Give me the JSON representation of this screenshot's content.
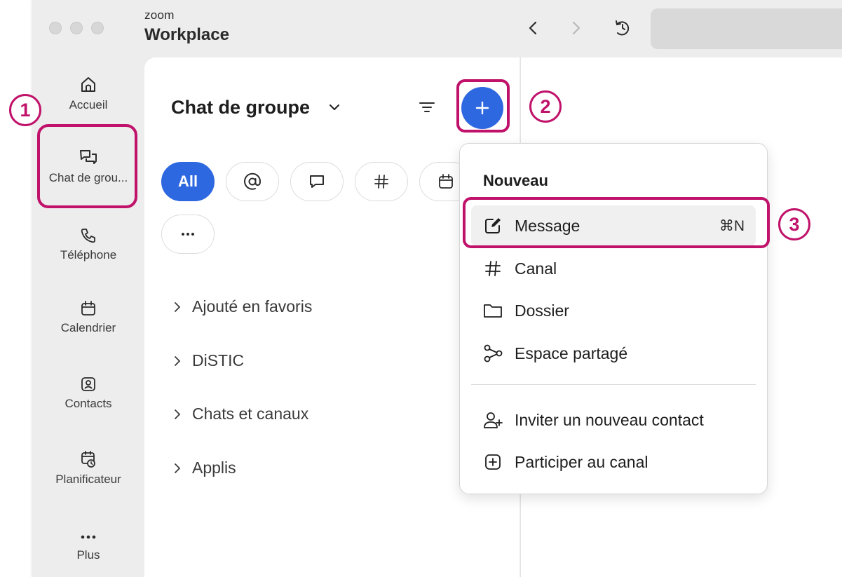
{
  "app": {
    "brand_top": "zoom",
    "brand_name": "Workplace"
  },
  "sidebar": {
    "items": [
      {
        "label": "Accueil",
        "icon": "home-icon"
      },
      {
        "label": "Chat de grou...",
        "icon": "chat-icon"
      },
      {
        "label": "Téléphone",
        "icon": "phone-icon"
      },
      {
        "label": "Calendrier",
        "icon": "calendar-icon"
      },
      {
        "label": "Contacts",
        "icon": "contacts-icon"
      },
      {
        "label": "Planificateur",
        "icon": "scheduler-icon"
      },
      {
        "label": "Plus",
        "icon": "more-icon"
      }
    ]
  },
  "panel": {
    "title": "Chat de groupe",
    "filter_all": "All",
    "sections": [
      "Ajouté en favoris",
      "DiSTIC",
      "Chats et canaux",
      "Applis"
    ]
  },
  "menu": {
    "header": "Nouveau",
    "items": [
      {
        "label": "Message",
        "icon": "compose-icon",
        "shortcut": "⌘N"
      },
      {
        "label": "Canal",
        "icon": "hash-icon"
      },
      {
        "label": "Dossier",
        "icon": "folder-icon"
      },
      {
        "label": "Espace partagé",
        "icon": "shared-space-icon"
      },
      {
        "label": "Inviter un nouveau contact",
        "icon": "add-contact-icon"
      },
      {
        "label": "Participer au canal",
        "icon": "join-channel-icon"
      }
    ]
  },
  "annotations": {
    "step1": "1",
    "step2": "2",
    "step3": "3"
  },
  "colors": {
    "accent": "#2e68e0",
    "annotation": "#c0126a",
    "sidebar_bg": "#ededed"
  }
}
